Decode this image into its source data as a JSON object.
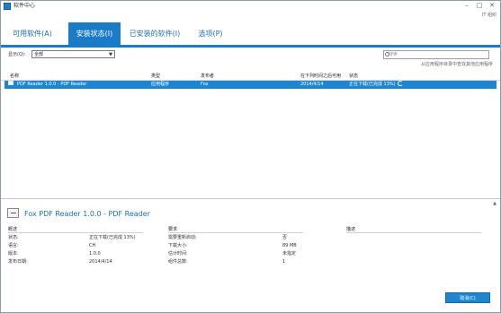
{
  "window": {
    "title": "软件中心",
    "org": "IT 组织",
    "buttons": [
      "–",
      "□",
      "✕"
    ]
  },
  "tabs": [
    {
      "label": "可用软件(A)",
      "active": false
    },
    {
      "label": "安装状态(I)",
      "active": true
    },
    {
      "label": "已安装的软件(I)",
      "active": false
    },
    {
      "label": "选项(P)",
      "active": false
    }
  ],
  "filter": {
    "label": "显示(Q):",
    "value": "全部"
  },
  "search": {
    "placeholder": "搜索"
  },
  "hint": "从应用程序目录中查找其他应用程序",
  "columns": [
    "名称",
    "类型",
    "发布者",
    "在下列时间之后可用",
    "状态"
  ],
  "rows": [
    {
      "name": "PDF Reader 1.0.0 - PDF Reader",
      "type": "应用程序",
      "publisher": "Fox",
      "available": "2014/4/14",
      "status": "正在下载(已完成 13%)"
    }
  ],
  "detail": {
    "title": "Fox PDF Reader 1.0.0 - PDF Reader",
    "sections": {
      "overview": "概述",
      "requirements": "要求",
      "description": "描述"
    },
    "overview_items": [
      {
        "key": "状态:",
        "value": "正在下载(已完成 13%)"
      },
      {
        "key": "语言:",
        "value": "CH"
      },
      {
        "key": "版本:",
        "value": "1.0.0"
      },
      {
        "key": "发布日期:",
        "value": "2014/4/14"
      }
    ],
    "requirement_items": [
      {
        "key": "需要重新启动:",
        "value": "否"
      },
      {
        "key": "下载大小:",
        "value": "89 MB"
      },
      {
        "key": "估计时间:",
        "value": "未指定"
      },
      {
        "key": "组件总数:",
        "value": "1"
      }
    ]
  },
  "actions": {
    "cancel": "取消(C)"
  },
  "colors": {
    "accent": "#1c7bc6",
    "selected_row": "#1e86d1",
    "link_text": "#1b6fb5"
  }
}
